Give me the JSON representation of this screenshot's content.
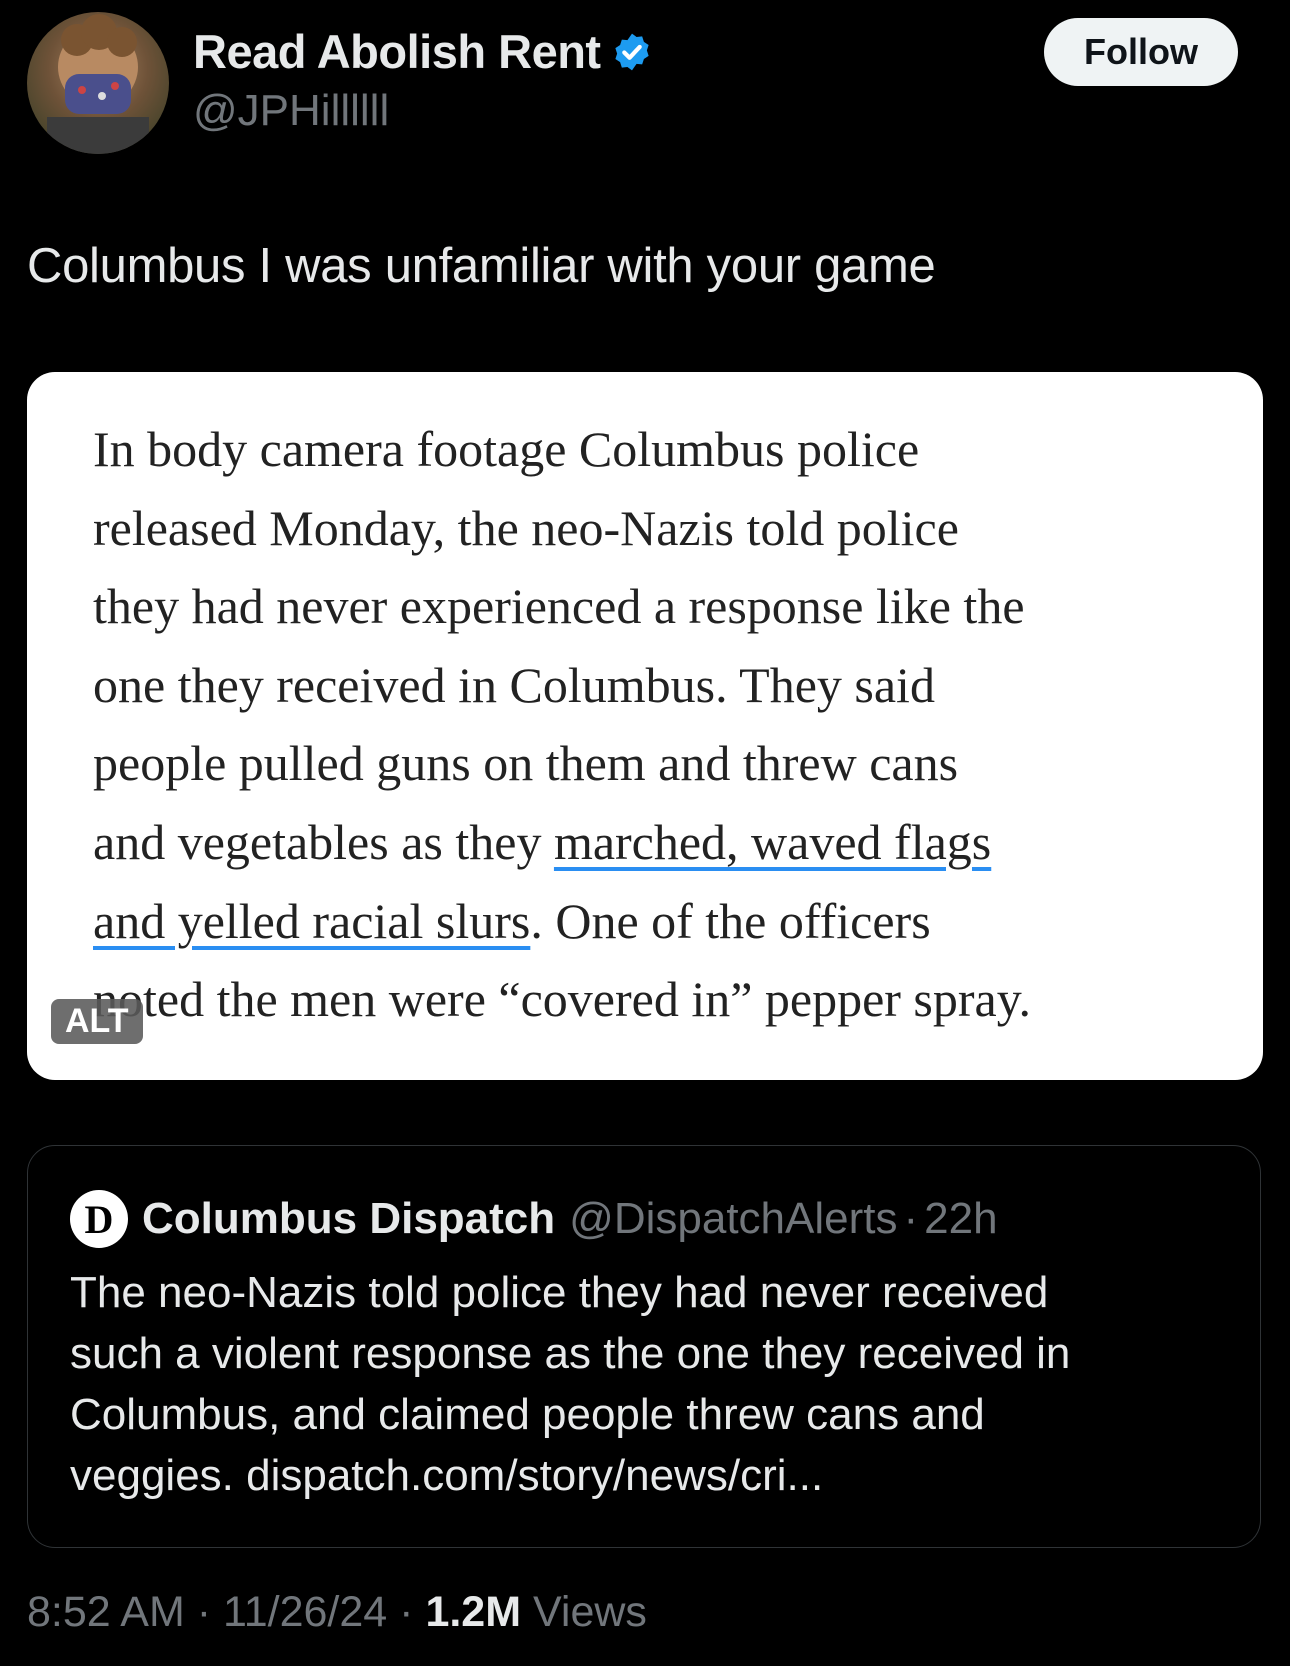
{
  "author": {
    "display_name": "Read Abolish Rent",
    "handle": "@JPHillllll",
    "verified": true,
    "follow_label": "Follow"
  },
  "tweet": {
    "text": "Columbus I was unfamiliar with your game"
  },
  "media": {
    "alt_badge": "ALT",
    "article_lines": [
      [
        "In body camera footage Columbus police"
      ],
      [
        "released Monday, the neo-Nazis told police"
      ],
      [
        "they had never experienced a response like the"
      ],
      [
        "one they received in Columbus. They said"
      ],
      [
        "people pulled guns on them and threw cans"
      ],
      [
        "and vegetables as they ",
        "marched, waved flags"
      ],
      [
        "and yelled racial slurs",
        ". One of the officers"
      ],
      [
        "noted the men were “covered in” pepper spray."
      ]
    ]
  },
  "quote": {
    "logo_letter": "D",
    "name": "Columbus Dispatch",
    "handle": "@DispatchAlerts",
    "separator": "·",
    "time": "22h",
    "lines": [
      "The neo-Nazis told police they had never received",
      "such a violent response as the one they received in",
      "Columbus, and claimed people threw cans and",
      "veggies. dispatch.com/story/news/cri..."
    ]
  },
  "meta": {
    "time": "8:52 AM",
    "date": "11/26/24",
    "separator": "·",
    "views_count": "1.2M",
    "views_label": "Views"
  },
  "colors": {
    "background": "#000000",
    "verified": "#1d9bf0",
    "link_underline": "#2a8ef2",
    "muted": "#71767b"
  }
}
